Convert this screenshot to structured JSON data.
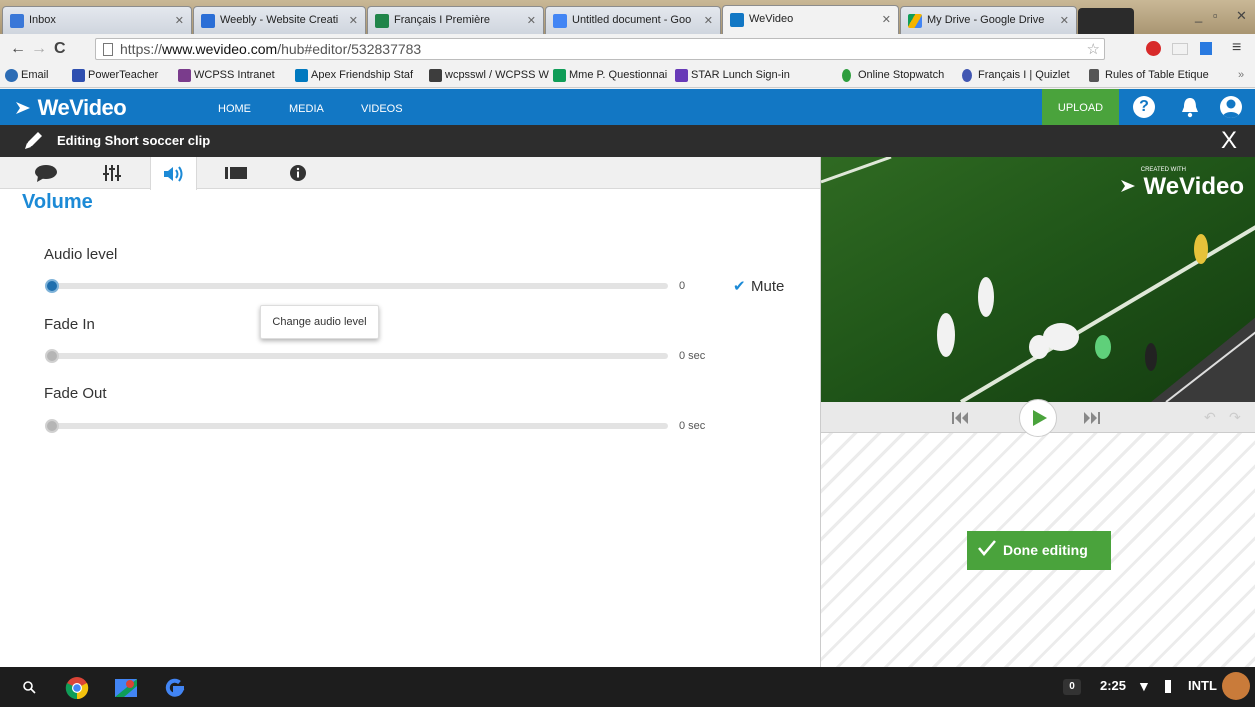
{
  "browser": {
    "tabs": [
      {
        "label": "Inbox",
        "favicon": "inbox-icon",
        "active": false
      },
      {
        "label": "Weebly - Website Creati",
        "favicon": "weebly-icon",
        "active": false
      },
      {
        "label": "Français I Première",
        "favicon": "classroom-icon",
        "active": false
      },
      {
        "label": "Untitled document - Goo",
        "favicon": "docs-icon",
        "active": false
      },
      {
        "label": "WeVideo",
        "favicon": "wevideo-icon",
        "active": true
      },
      {
        "label": "My Drive - Google Drive",
        "favicon": "drive-icon",
        "active": false
      }
    ],
    "url_prefix": "https://",
    "url_domain": "www.wevideo.com",
    "url_path": "/hub#editor/532837783",
    "bookmarks": [
      {
        "label": "Email",
        "icon": "globe-icon"
      },
      {
        "label": "PowerTeacher",
        "icon": "powerteacher-icon"
      },
      {
        "label": "WCPSS Intranet",
        "icon": "intranet-icon"
      },
      {
        "label": "Apex Friendship Staf",
        "icon": "trello-icon"
      },
      {
        "label": "wcpsswl / WCPSS W",
        "icon": "pbworks-icon"
      },
      {
        "label": "Mme P. Questionnai",
        "icon": "sheets-icon"
      },
      {
        "label": "STAR Lunch Sign-in",
        "icon": "forms-icon"
      },
      {
        "label": "Online Stopwatch",
        "icon": "stopwatch-icon"
      },
      {
        "label": "Français I | Quizlet",
        "icon": "quizlet-icon"
      },
      {
        "label": "Rules of Table Etique",
        "icon": "doc-icon"
      }
    ]
  },
  "wevideo": {
    "logo": "WeVideo",
    "nav": [
      "HOME",
      "MEDIA",
      "VIDEOS"
    ],
    "upload_label": "UPLOAD",
    "help_label": "?",
    "editing_title": "Editing Short soccer clip",
    "close_label": "X",
    "colors": {
      "header": "#1277c4",
      "editbar": "#2d2d2d",
      "accent": "#1c8ad6",
      "green": "#4aa33c"
    }
  },
  "panel": {
    "tabs": [
      "comment-icon",
      "equalizer-icon",
      "volume-icon",
      "filmstrip-icon",
      "info-icon"
    ],
    "active_tab": "volume-icon",
    "title": "Volume",
    "audio_level": {
      "label": "Audio level",
      "value": "0",
      "fraction": 0.0
    },
    "mute": {
      "label": "Mute",
      "checked": true
    },
    "tooltip": "Change audio level",
    "fade_in": {
      "label": "Fade In",
      "value": "0 sec",
      "fraction": 0.0
    },
    "fade_out": {
      "label": "Fade Out",
      "value": "0 sec",
      "fraction": 0.0
    }
  },
  "preview": {
    "watermark_caption": "CREATED WITH",
    "watermark": "WeVideo",
    "done_label": "Done editing"
  },
  "taskbar": {
    "notification_count": "0",
    "time": "2:25",
    "input_method": "INTL"
  }
}
